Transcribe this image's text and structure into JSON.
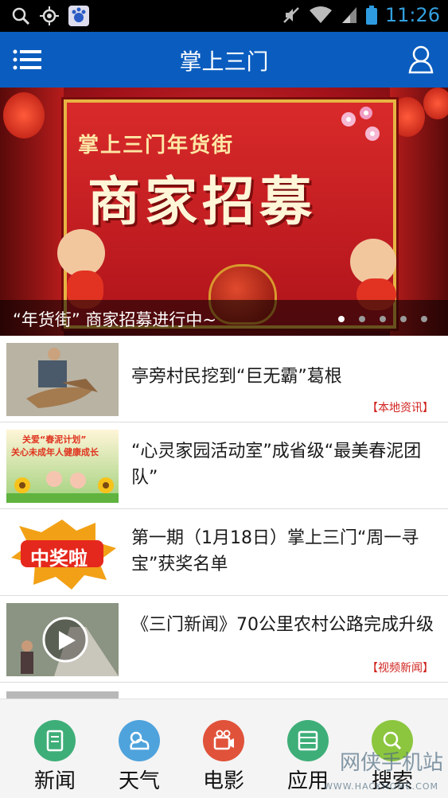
{
  "status_bar": {
    "time": "11:26",
    "icons": [
      "search-icon",
      "gps-icon",
      "baidu-icon",
      "mute-icon",
      "wifi-icon",
      "signal-icon",
      "battery-icon"
    ]
  },
  "header": {
    "title": "掌上三门",
    "menu_icon": "list-menu-icon",
    "user_icon": "user-icon"
  },
  "banner": {
    "subtitle": "掌上三门年货街",
    "main_text": "商家招募",
    "caption": "“年货街” 商家招募进行中~",
    "slide_count": 5,
    "active_slide": 1
  },
  "news": [
    {
      "title": "亭旁村民挖到“巨无霸”葛根",
      "tag": "【本地资讯】"
    },
    {
      "title": "“心灵家园活动室”成省级“最美春泥团队”",
      "tag": ""
    },
    {
      "title": "第一期（1月18日）掌上三门“周一寻宝”获奖名单",
      "tag": ""
    },
    {
      "title": "《三门新闻》70公里农村公路完成升级",
      "tag": "【视频新闻】"
    }
  ],
  "thumb_text": {
    "item2_banner_line1": "关爱“春泥计划”",
    "item2_banner_line2": "关心未成年人健康成长",
    "item3_badge": "中奖啦"
  },
  "bottom_nav": [
    {
      "label": "新闻",
      "icon": "news-icon",
      "color": "#3eae78"
    },
    {
      "label": "天气",
      "icon": "weather-icon",
      "color": "#4fa3dc"
    },
    {
      "label": "电影",
      "icon": "movie-icon",
      "color": "#e0533a"
    },
    {
      "label": "应用",
      "icon": "apps-icon",
      "color": "#3eae78"
    },
    {
      "label": "搜索",
      "icon": "search-icon",
      "color": "#8cc63f"
    }
  ],
  "watermark": {
    "text": "网侠手机站",
    "sub": "WWW.HACKHOME.COM"
  }
}
